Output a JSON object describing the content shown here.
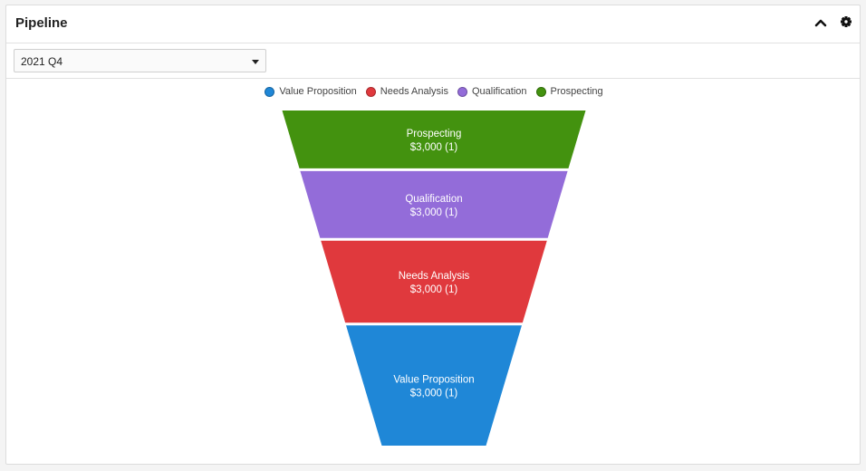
{
  "dashlet": {
    "title": "Pipeline",
    "collapse_icon": "chevron-up-icon",
    "settings_icon": "gear-icon"
  },
  "filter": {
    "selected": "2021 Q4"
  },
  "chart_data": {
    "type": "funnel",
    "legend_position": "top",
    "legend": [
      {
        "name": "Value Proposition",
        "color": "#1f87d7"
      },
      {
        "name": "Needs Analysis",
        "color": "#e0393d"
      },
      {
        "name": "Qualification",
        "color": "#936cd9"
      },
      {
        "name": "Prospecting",
        "color": "#43920f"
      }
    ],
    "stages": [
      {
        "name": "Prospecting",
        "value": 3000,
        "count": 1,
        "label": "$3,000 (1)",
        "color": "#43920f"
      },
      {
        "name": "Qualification",
        "value": 3000,
        "count": 1,
        "label": "$3,000 (1)",
        "color": "#936cd9"
      },
      {
        "name": "Needs Analysis",
        "value": 3000,
        "count": 1,
        "label": "$3,000 (1)",
        "color": "#e0393d"
      },
      {
        "name": "Value Proposition",
        "value": 3000,
        "count": 1,
        "label": "$3,000 (1)",
        "color": "#1f87d7"
      }
    ]
  }
}
